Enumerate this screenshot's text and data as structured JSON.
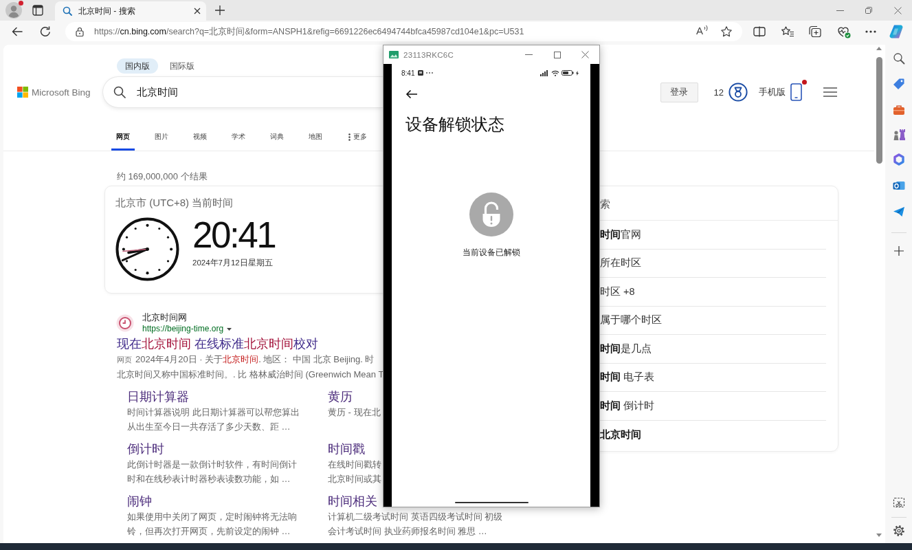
{
  "browser": {
    "profile_badge": true,
    "tabs": [
      {
        "title": "北京时间 - 搜索",
        "selected": true
      }
    ],
    "address": {
      "scheme": "https://",
      "host": "cn.bing.com",
      "path": "/search?q=北京时间&form=ANSPH1&refig=6691226ec6494744bfca45987cd104e1&pc=U531"
    },
    "read_aloud_glyph": "A"
  },
  "page": {
    "region_tabs": [
      {
        "label": "国内版",
        "selected": true
      },
      {
        "label": "国际版",
        "selected": false
      }
    ],
    "logo": "Microsoft Bing",
    "search": {
      "value": "北京时间"
    },
    "header": {
      "login": "登录",
      "points": "12",
      "mobile": "手机版",
      "mobile_badge": true
    },
    "nav": [
      {
        "label": "网页",
        "selected": true,
        "kind": "tab"
      },
      {
        "label": "图片",
        "selected": false,
        "kind": "tab"
      },
      {
        "label": "视频",
        "selected": false,
        "kind": "tab"
      },
      {
        "label": "学术",
        "selected": false,
        "kind": "tab"
      },
      {
        "label": "词典",
        "selected": false,
        "kind": "tab"
      },
      {
        "label": "地图",
        "selected": false,
        "kind": "tab"
      },
      {
        "label": "更多",
        "selected": false,
        "kind": "more"
      }
    ],
    "result_count": "约 169,000,000 个结果",
    "time_card": {
      "heading": "北京市 (UTC+8) 当前时间",
      "time": "20:41",
      "date": "2024年7月12日星期五"
    },
    "result": {
      "site": "北京时间网",
      "url": "https://beijing-time.org",
      "title": [
        {
          "text": "现在",
          "highlight": false
        },
        {
          "text": "北京时间",
          "highlight": true
        },
        {
          "text": " 在线标准",
          "highlight": false
        },
        {
          "text": "北京时间",
          "highlight": true
        },
        {
          "text": "校对",
          "highlight": false
        }
      ],
      "snippet": {
        "label": "网页",
        "lines": [
          [
            {
              "text": "2024年4月20日 · 关于",
              "highlight": false
            },
            {
              "text": "北京时间",
              "highlight": true
            },
            {
              "text": ". 地区： 中国 北京 Beijing. 时",
              "highlight": false
            }
          ],
          [
            {
              "text": "北京时间又称中国标准时间。. 比 格林威治时间 (Greenwich Mean T",
              "highlight": false
            }
          ]
        ]
      },
      "deep_links": [
        {
          "title": "日期计算器",
          "desc_lines": [
            "时间计算器说明 此日期计算器可以帮您算出",
            "从出生至今日一共存活了多少天数、距 …"
          ]
        },
        {
          "title": "黄历",
          "desc_lines": [
            "黄历 - 现在北"
          ]
        },
        {
          "title": "倒计时",
          "desc_lines": [
            "此倒计时器是一款倒计时软件，有时间倒计",
            "时和在线秒表计时器秒表读数功能，如 …"
          ]
        },
        {
          "title": "时间戳",
          "desc_lines": [
            "在线时间戳转",
            "北京时间或其"
          ]
        },
        {
          "title": "闹钟",
          "desc_lines": [
            "如果使用中关闭了网页，定时闹钟将无法响",
            "铃，但再次打开网页，先前设定的闹钟 …"
          ]
        },
        {
          "title": "时间相关",
          "desc_lines": [
            "计算机二级考试时间 英语四级考试时间 初级",
            "会计考试时间 执业药师报名时间 雅思 …"
          ]
        }
      ]
    },
    "related": {
      "heading": "索",
      "items": [
        {
          "text": "**时间**官网"
        },
        {
          "text": "所在时区"
        },
        {
          "text": "时区 +8"
        },
        {
          "text": "属于哪个时区"
        },
        {
          "text": "**时间**是几点"
        },
        {
          "text": "**时间** 电子表"
        },
        {
          "text": "**时间** 倒计时"
        },
        {
          "text": "**北京时间**"
        }
      ]
    }
  },
  "phone": {
    "title": "23113RKC6C",
    "status_time": "8:41",
    "page_title": "设备解锁状态",
    "locked": false,
    "status": "当前设备已解锁"
  }
}
